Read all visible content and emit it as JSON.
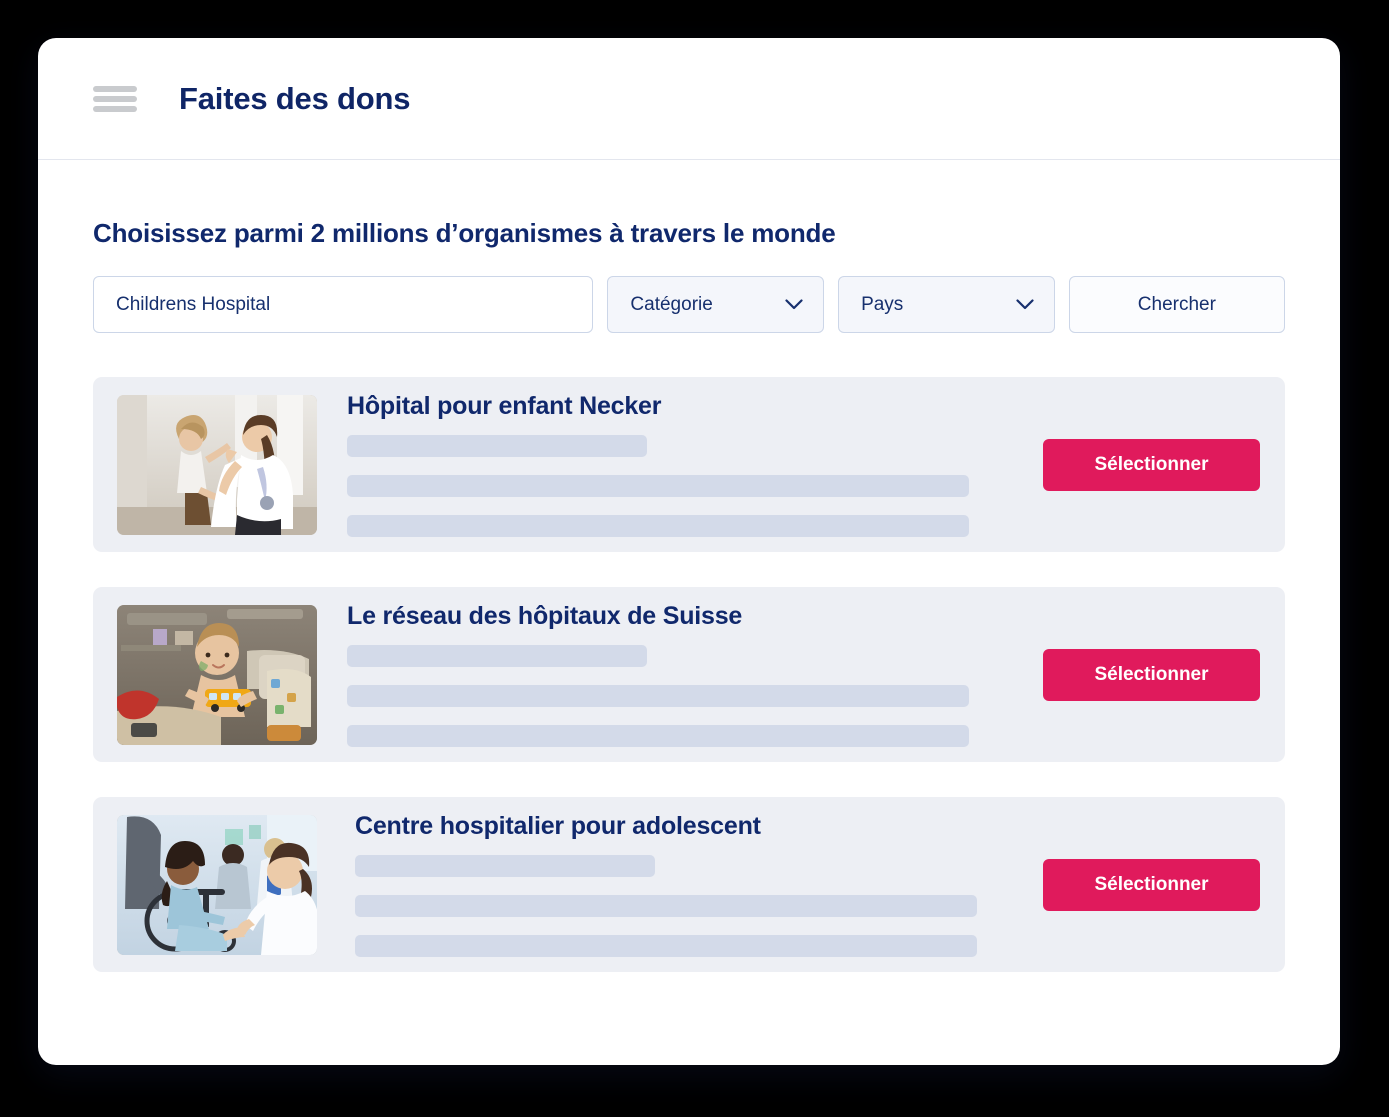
{
  "window": {
    "background_color": "#000000",
    "card_color": "#ffffff"
  },
  "header": {
    "menu_icon": "hamburger-menu-icon",
    "title": "Faites des dons"
  },
  "main": {
    "heading": "Choisissez parmi 2 millions d’organismes à travers le monde",
    "search": {
      "value": "Childrens Hospital",
      "placeholder": "Childrens Hospital",
      "category_label": "Catégorie",
      "country_label": "Pays",
      "submit_label": "Chercher",
      "chevron_icon": "chevron-down-icon"
    },
    "select_button_label": "Sélectionner",
    "accent_color": "#e01a5c",
    "title_color": "#10286c",
    "card_background": "#edeff4",
    "placeholder_bar_color": "#d3dae9",
    "results": [
      {
        "title": "Hôpital pour enfant Necker",
        "image_alt": "doctor-high-fiving-child-photo"
      },
      {
        "title": "Le réseau des hôpitaux de Suisse",
        "image_alt": "child-in-hospital-bed-with-toy-bus-photo"
      },
      {
        "title": "Centre hospitalier pour adolescent",
        "image_alt": "teen-in-wheelchair-with-doctor-photo"
      }
    ]
  }
}
